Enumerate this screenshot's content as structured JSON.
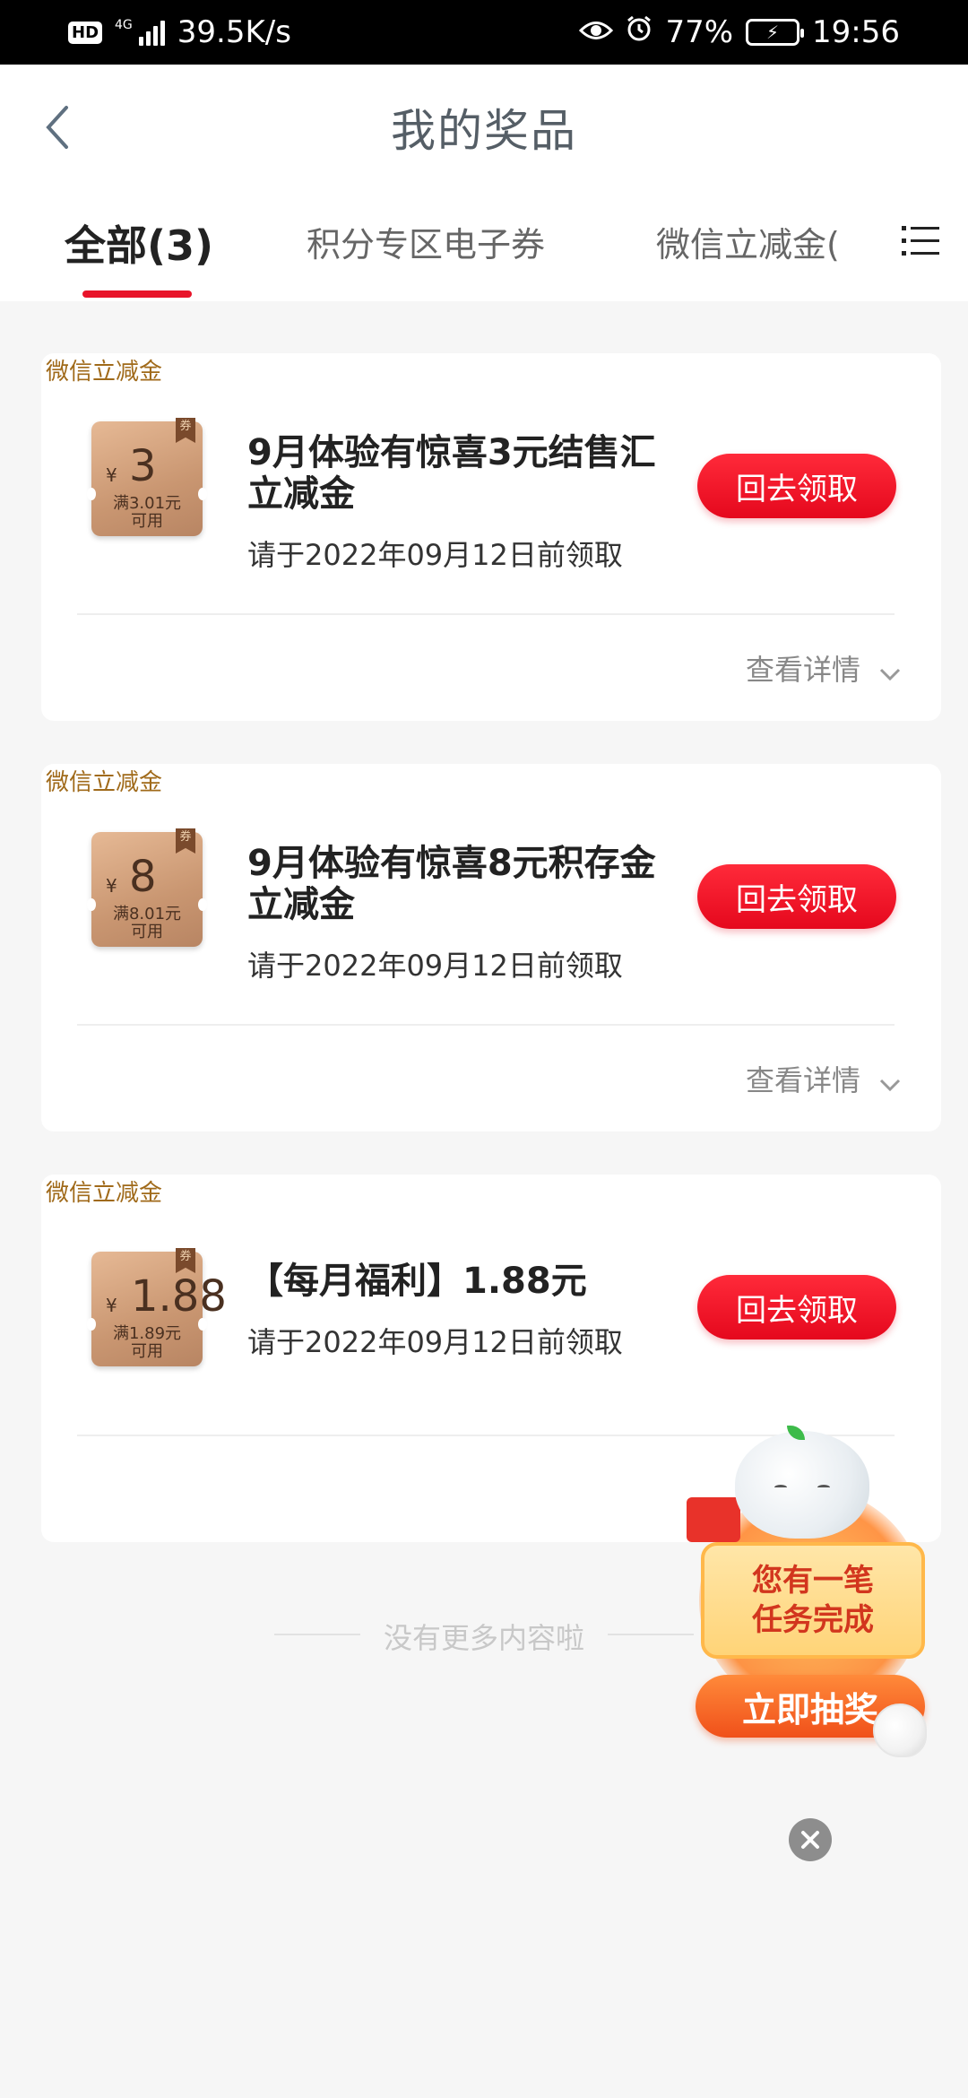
{
  "status_bar": {
    "hd": "HD",
    "network_type": "4G",
    "speed": "39.5K/s",
    "battery": "77%",
    "time": "19:56"
  },
  "header": {
    "title": "我的奖品"
  },
  "tabs": [
    {
      "label": "全部(3)",
      "active": true
    },
    {
      "label": "积分专区电子券",
      "active": false
    },
    {
      "label": "微信立减金(",
      "active": false
    }
  ],
  "prizes": [
    {
      "tag": "微信立减金",
      "coupon_ribbon": "券",
      "currency": "¥",
      "amount": "3",
      "condition_line1": "满3.01元",
      "condition_line2": "可用",
      "title": "9月体验有惊喜3元结售汇立减金",
      "deadline": "请于2022年09月12日前领取",
      "button": "回去领取",
      "details": "查看详情"
    },
    {
      "tag": "微信立减金",
      "coupon_ribbon": "券",
      "currency": "¥",
      "amount": "8",
      "condition_line1": "满8.01元",
      "condition_line2": "可用",
      "title": "9月体验有惊喜8元积存金立减金",
      "deadline": "请于2022年09月12日前领取",
      "button": "回去领取",
      "details": "查看详情"
    },
    {
      "tag": "微信立减金",
      "coupon_ribbon": "券",
      "currency": "¥",
      "amount": "1.88",
      "condition_line1": "满1.89元",
      "condition_line2": "可用",
      "title": "【每月福利】1.88元",
      "deadline": "请于2022年09月12日前领取",
      "button": "回去领取"
    }
  ],
  "end_note": "没有更多内容啦",
  "float_widget": {
    "message_line1": "您有一笔",
    "message_line2": "任务完成",
    "button": "立即抽奖"
  },
  "colors": {
    "accent_red": "#e8142a",
    "tag_brown": "#a06a1a",
    "coupon_gold": "#c99671"
  }
}
